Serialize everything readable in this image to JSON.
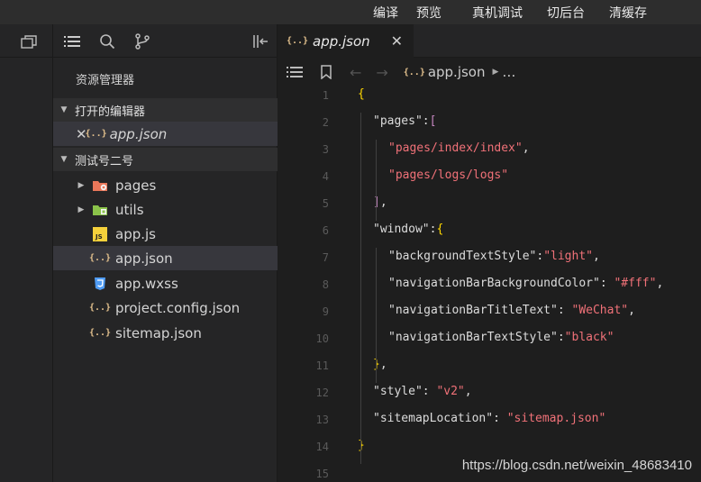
{
  "toolbar": {
    "compile": "编译",
    "preview": "预览",
    "real_device_debug": "真机调试",
    "cut_background": "切后台",
    "clear_cache": "清缓存"
  },
  "explorer": {
    "title": "资源管理器",
    "open_editors_label": "打开的编辑器",
    "open_editor_file": "app.json",
    "project_label": "测试号二号",
    "files": [
      {
        "name": "pages",
        "icon": "folder-pages-icon"
      },
      {
        "name": "utils",
        "icon": "folder-utils-icon"
      },
      {
        "name": "app.js",
        "icon": "js-file-icon"
      },
      {
        "name": "app.json",
        "icon": "json-file-icon"
      },
      {
        "name": "app.wxss",
        "icon": "css-file-icon"
      },
      {
        "name": "project.config.json",
        "icon": "json-file-icon"
      },
      {
        "name": "sitemap.json",
        "icon": "json-file-icon"
      }
    ]
  },
  "editor": {
    "tab_name": "app.json",
    "tab_close": "✕",
    "breadcrumb_file": "app.json",
    "breadcrumb_more": "…",
    "line_numbers": [
      "1",
      "2",
      "3",
      "4",
      "5",
      "6",
      "7",
      "8",
      "9",
      "10",
      "11",
      "12",
      "13",
      "14",
      "15"
    ],
    "lines": [
      [
        "{"
      ],
      [
        "\"pages\"",
        ":",
        "["
      ],
      [
        "\"pages/index/index\"",
        ","
      ],
      [
        "\"pages/logs/logs\""
      ],
      [
        "]",
        ","
      ],
      [
        "\"window\"",
        ":",
        "{"
      ],
      [
        "\"backgroundTextStyle\"",
        ":",
        "\"light\"",
        ","
      ],
      [
        "\"navigationBarBackgroundColor\"",
        ": ",
        "\"#fff\"",
        ","
      ],
      [
        "\"navigationBarTitleText\"",
        ": ",
        "\"WeChat\"",
        ","
      ],
      [
        "\"navigationBarTextStyle\"",
        ":",
        "\"black\""
      ],
      [
        "}",
        ","
      ],
      [
        "\"style\"",
        ": ",
        "\"v2\"",
        ","
      ],
      [
        "\"sitemapLocation\"",
        ": ",
        "\"sitemap.json\""
      ],
      [
        "}"
      ],
      [
        ""
      ]
    ]
  },
  "watermark": "https://blog.csdn.net/weixin_48683410",
  "colors": {
    "accent_json": "#e2c08d",
    "string": "#f07178",
    "punct": "#c586c0",
    "folder": "#e9775a",
    "css": "#4f9cf5"
  }
}
